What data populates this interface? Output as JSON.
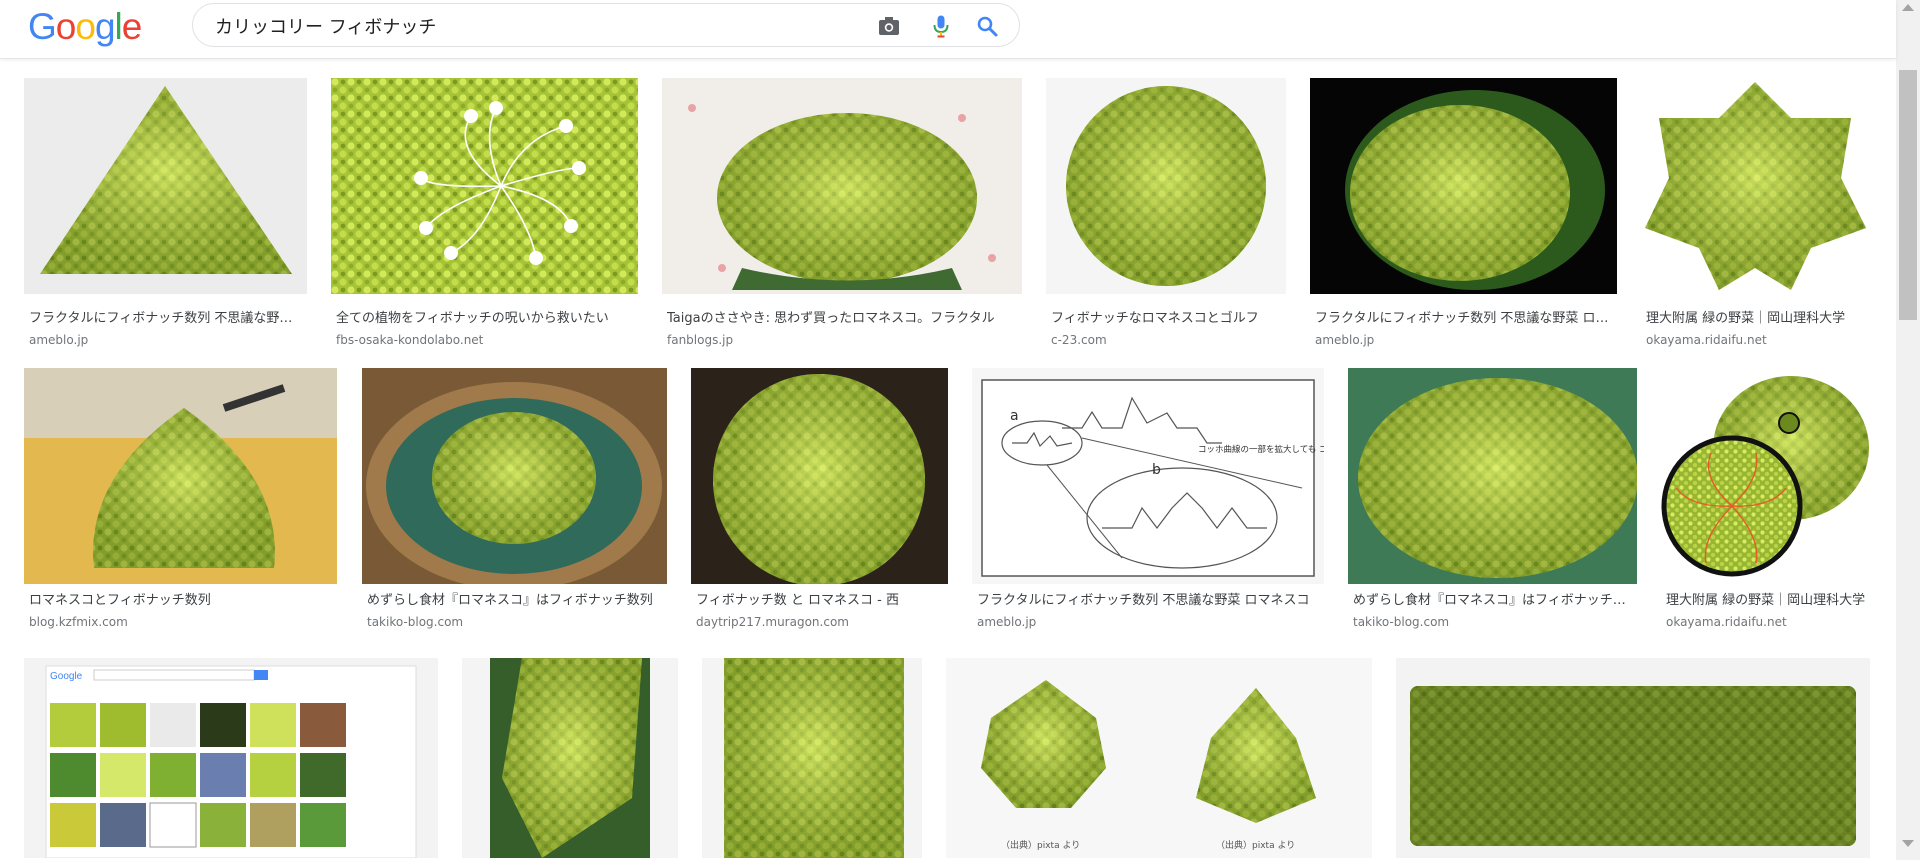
{
  "header": {
    "logo": [
      "G",
      "o",
      "o",
      "g",
      "l",
      "e"
    ],
    "logo_colors": [
      "#4285F4",
      "#EA4335",
      "#FBBC05",
      "#4285F4",
      "#34A853",
      "#EA4335"
    ],
    "search_query": "カリッコリー フィボナッチ",
    "icons": [
      "camera-icon",
      "mic-icon",
      "search-icon"
    ]
  },
  "results": [
    {
      "title": "フラクタルにフィボナッチ数列 不思議な野菜 ロマネスコ",
      "site": "ameblo.jp"
    },
    {
      "title": "全ての植物をフィボナッチの呪いから救いたい",
      "site": "fbs-osaka-kondolabo.net"
    },
    {
      "title": "Taigaのささやき: 思わず買ったロマネスコ。フラクタル",
      "site": "fanblogs.jp"
    },
    {
      "title": "フィボナッチなロマネスコとゴルフ",
      "site": "c-23.com"
    },
    {
      "title": "フラクタルにフィボナッチ数列 不思議な野菜 ロマネスコ",
      "site": "ameblo.jp"
    },
    {
      "title": "理大附属 緑の野菜｜岡山理科大学",
      "site": "okayama.ridaifu.net"
    },
    {
      "title": "ロマネスコとフィボナッチ数列",
      "site": "blog.kzfmix.com"
    },
    {
      "title": "めずらし食材『ロマネスコ』はフィボナッチ数列",
      "site": "takiko-blog.com"
    },
    {
      "title": "フィボナッチ数 と ロマネスコ - 西",
      "site": "daytrip217.muragon.com"
    },
    {
      "title": "フラクタルにフィボナッチ数列 不思議な野菜 ロマネスコ",
      "site": "ameblo.jp"
    },
    {
      "title": "めずらし食材『ロマネスコ』はフィボナッチ数列",
      "site": "takiko-blog.com"
    },
    {
      "title": "理大附属 緑の野菜｜岡山理科大学",
      "site": "okayama.ridaifu.net"
    }
  ],
  "diagram": {
    "label_a": "a",
    "label_b": "b",
    "note": "コッホ曲線の一部を拡大しても コッホ曲線が出てくる…"
  },
  "mini_logo": "Google",
  "credits": [
    "（出典）pixta より",
    "（出典）pixta より"
  ],
  "colors": {
    "romanesco_light": "#c9e04a",
    "romanesco_mid": "#9cbf2c",
    "romanesco_dark": "#5f7d1a",
    "site_text": "#70757a",
    "title_text": "#3c4043"
  }
}
